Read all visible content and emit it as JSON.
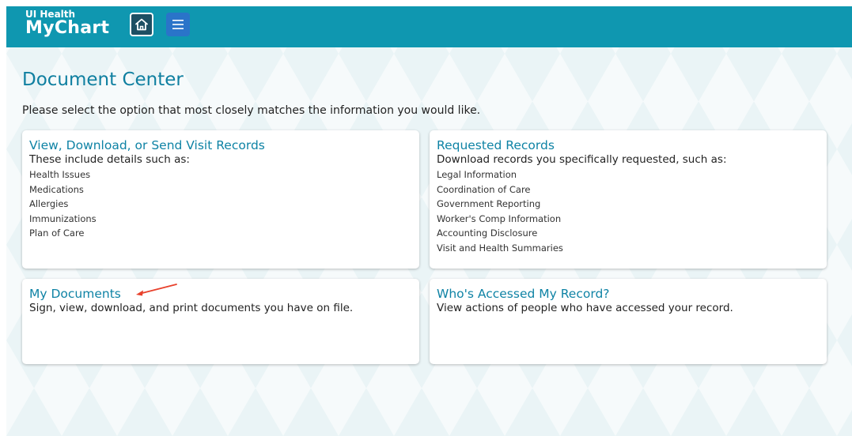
{
  "header": {
    "logo_small": "UI Health",
    "logo_big": "MyChart",
    "home_icon": "home-icon",
    "menu_icon": "menu-icon",
    "bar_color": "#0f97b0"
  },
  "page": {
    "title": "Document Center",
    "intro": "Please select the option that most closely matches the information you would like."
  },
  "cards": [
    {
      "title": "View, Download, or Send Visit Records",
      "description": "These include details such as:",
      "items": [
        "Health Issues",
        "Medications",
        "Allergies",
        "Immunizations",
        "Plan of Care"
      ]
    },
    {
      "title": "Requested Records",
      "description": "Download records you specifically requested, such as:",
      "items": [
        "Legal Information",
        "Coordination of Care",
        "Government Reporting",
        "Worker's Comp Information",
        "Accounting Disclosure",
        "Visit and Health Summaries"
      ]
    },
    {
      "title": "My Documents",
      "description": "Sign, view, download, and print documents you have on file.",
      "items": []
    },
    {
      "title": "Who's Accessed My Record?",
      "description": "View actions of people who have accessed your record.",
      "items": []
    }
  ],
  "annotation": {
    "arrow_color": "#e8412c"
  }
}
